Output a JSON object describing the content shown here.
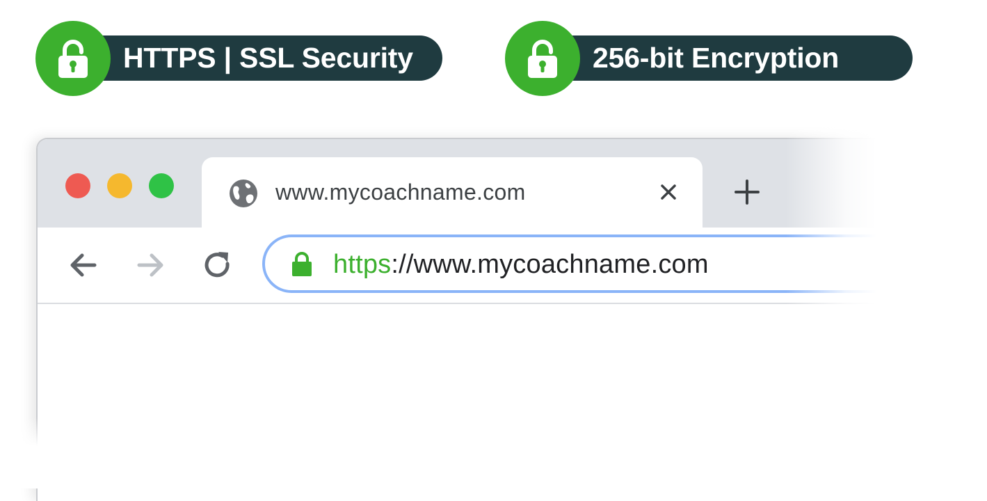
{
  "badges": [
    {
      "label": "HTTPS | SSL Security",
      "icon": "lock-icon"
    },
    {
      "label": "256-bit Encryption",
      "icon": "lock-icon"
    }
  ],
  "colors": {
    "badge_circle": "#3cb02e",
    "badge_pill": "#1f3b40",
    "traffic_red": "#ee5a52",
    "traffic_yellow": "#f5b82e",
    "traffic_green": "#2fc246",
    "url_secure": "#3cb02e",
    "omnibox_focus": "#8ab4f8"
  },
  "browser": {
    "window_controls": [
      "close",
      "minimize",
      "maximize"
    ],
    "tab": {
      "favicon": "globe-icon",
      "title": "www.mycoachname.com",
      "close_icon": "close-icon"
    },
    "new_tab_icon": "plus-icon",
    "toolbar": {
      "back_icon": "arrow-left-icon",
      "forward_icon": "arrow-right-icon",
      "reload_icon": "reload-icon"
    },
    "address_bar": {
      "lock_icon": "lock-icon",
      "scheme": "https",
      "rest": "://www.mycoachname.com"
    }
  }
}
